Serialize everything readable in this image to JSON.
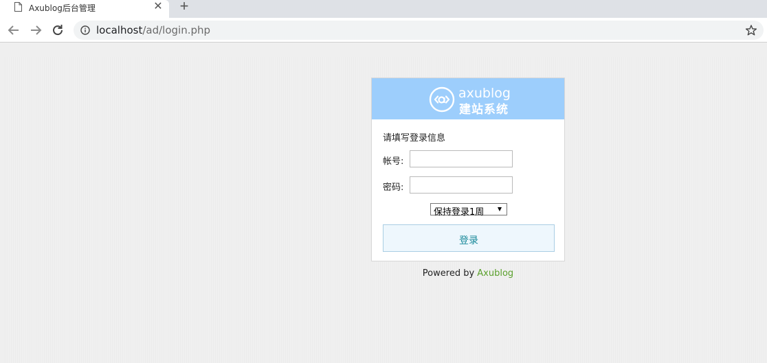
{
  "browser": {
    "tab_title": "Axublog后台管理",
    "url_host": "localhost",
    "url_path": "/ad/login.php",
    "icons": {
      "tab": "page-icon",
      "close": "close-icon",
      "new_tab": "plus-icon",
      "back": "arrow-left-icon",
      "forward": "arrow-right-icon",
      "reload": "reload-icon",
      "info": "info-icon",
      "bookmark": "star-icon"
    }
  },
  "login": {
    "logo_text_top": "axublog",
    "logo_text_bottom": "建站系统",
    "form_title": "请填写登录信息",
    "account_label": "帐号:",
    "password_label": "密码:",
    "account_value": "",
    "password_value": "",
    "remember_selected": "保持登录1周",
    "submit_label": "登录",
    "header_color": "#9dcefc"
  },
  "footer": {
    "powered_prefix": "Powered by ",
    "powered_link": "Axublog",
    "link_color": "#5aa02c"
  }
}
